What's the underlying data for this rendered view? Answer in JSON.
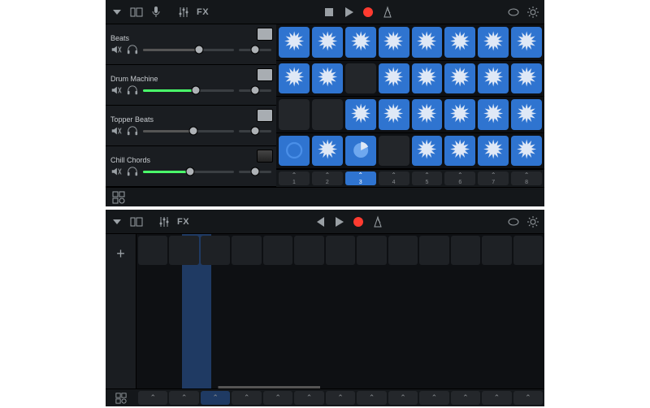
{
  "toolbar_top": {
    "fx_label": "FX"
  },
  "toolbar_bottom": {
    "fx_label": "FX"
  },
  "tracks": [
    {
      "name": "Beats",
      "muted": true,
      "vol": 0.62,
      "pan": 0.5,
      "green": false,
      "instrument": "drum-machine"
    },
    {
      "name": "Drum Machine",
      "muted": true,
      "vol": 0.58,
      "pan": 0.5,
      "green": true,
      "instrument": "drum-machine"
    },
    {
      "name": "Topper Beats",
      "muted": true,
      "vol": 0.55,
      "pan": 0.5,
      "green": false,
      "instrument": "drum-machine"
    },
    {
      "name": "Chill Chords",
      "muted": true,
      "vol": 0.52,
      "pan": 0.5,
      "green": true,
      "instrument": "keyboard"
    }
  ],
  "columns": [
    {
      "n": "1",
      "active": false
    },
    {
      "n": "2",
      "active": false
    },
    {
      "n": "3",
      "active": true
    },
    {
      "n": "4",
      "active": false
    },
    {
      "n": "5",
      "active": false
    },
    {
      "n": "6",
      "active": false
    },
    {
      "n": "7",
      "active": false
    },
    {
      "n": "8",
      "active": false
    }
  ],
  "grid": [
    [
      1,
      1,
      1,
      1,
      1,
      1,
      1,
      1
    ],
    [
      1,
      1,
      0,
      1,
      1,
      1,
      1,
      1
    ],
    [
      0,
      0,
      1,
      1,
      1,
      1,
      1,
      1
    ],
    [
      2,
      1,
      3,
      0,
      1,
      1,
      1,
      1
    ]
  ],
  "lower_columns": 13,
  "lower_active_index": 2
}
